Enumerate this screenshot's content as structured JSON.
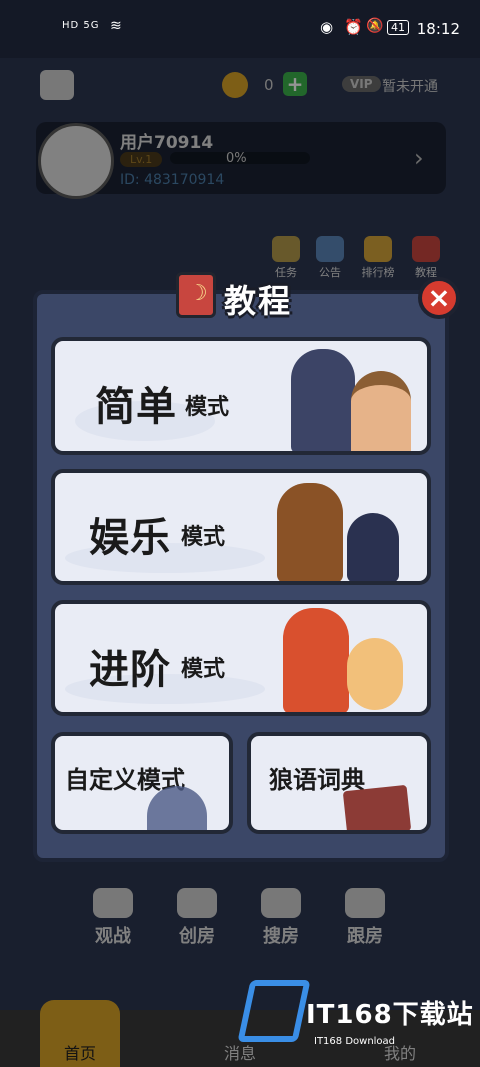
{
  "status_bar": {
    "left": "HD 5G",
    "time": "18:12",
    "battery": "41"
  },
  "top": {
    "coins": "0",
    "plus": "+",
    "vip_badge": "VIP",
    "vip_note": "暂未开通"
  },
  "profile": {
    "username": "用户70914",
    "level": "Lv.1",
    "progress": "0%",
    "id": "ID: 483170914"
  },
  "shortcuts": [
    "任务",
    "公告",
    "排行榜",
    "教程"
  ],
  "actions": [
    "观战",
    "创房",
    "搜房",
    "跟房"
  ],
  "tabs": [
    "首页",
    "消息",
    "我的"
  ],
  "modal": {
    "title": "教程",
    "close": "×",
    "cards": [
      {
        "big": "简单",
        "small": "模式"
      },
      {
        "big": "娱乐",
        "small": "模式"
      },
      {
        "big": "进阶",
        "small": "模式"
      }
    ],
    "custom": "自定义模式",
    "dictionary": "狼语词典"
  },
  "watermark": {
    "text": "IT168下载站",
    "sub": "IT168 Download"
  },
  "colors": {
    "modal_bg": "#3b4767",
    "card_bg": "#e9ecf5",
    "close_red": "#d63b2f",
    "accent_gold": "#d8a227"
  }
}
